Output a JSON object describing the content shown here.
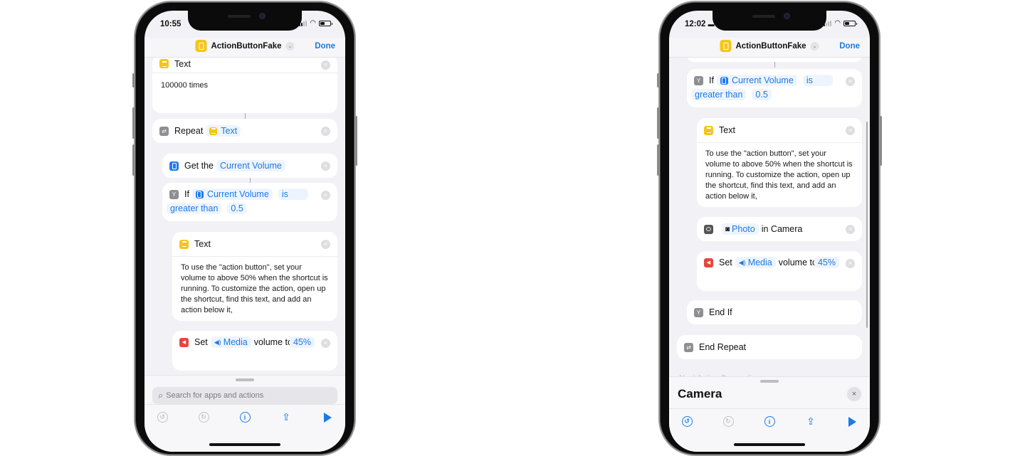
{
  "left_phone": {
    "status": {
      "time": "10:55"
    },
    "nav": {
      "title": "ActionButtonFake",
      "done_label": "Done"
    },
    "actions": {
      "text1": {
        "title": "Text",
        "body": "100000 times"
      },
      "repeat": {
        "label": "Repeat",
        "var": "Text"
      },
      "get": {
        "label": "Get the",
        "var": "Current Volume"
      },
      "if": {
        "label": "If",
        "var": "Current Volume",
        "op1": "is",
        "op2": "greater than",
        "value": "0.5"
      },
      "text2": {
        "title": "Text",
        "body": "To use the \"action button\", set your volume to above 50% when the shortcut is running. To customize the action, open up the shortcut, find this text, and add an action below it,"
      },
      "set": {
        "label": "Set",
        "var": "Media",
        "suffix": "volume to",
        "value": "45%"
      }
    },
    "search": {
      "placeholder": "Search for apps and actions"
    }
  },
  "right_phone": {
    "status": {
      "time": "12:02"
    },
    "nav": {
      "title": "ActionButtonFake",
      "done_label": "Done"
    },
    "actions": {
      "if": {
        "label": "If",
        "var": "Current Volume",
        "op1": "is",
        "op2": "greater than",
        "value": "0.5"
      },
      "text": {
        "title": "Text",
        "body": "To use the \"action button\", set your volume to above 50% when the shortcut is running. To customize the action, open up the shortcut, find this text, and add an action below it,"
      },
      "photo": {
        "var": "Photo",
        "suffix": "in Camera"
      },
      "set": {
        "label": "Set",
        "var": "Media",
        "suffix": "volume to",
        "value": "45%"
      },
      "end_if": {
        "label": "End If"
      },
      "end_repeat": {
        "label": "End Repeat"
      }
    },
    "suggestions_label": "Next Action Suggestions",
    "sheet": {
      "title": "Camera"
    }
  },
  "icons": {
    "close": "×",
    "chevron": "⌄",
    "repeat": "⇄",
    "if": "Y",
    "speaker": "🔊",
    "search": "⌕",
    "undo": "↺",
    "redo": "↻",
    "info": "i",
    "share": "⇪"
  },
  "colors": {
    "accent": "#1b7ae6",
    "text_action": "#f5c51b",
    "volume_action": "#1d7cf2",
    "media_action": "#e8453c"
  }
}
